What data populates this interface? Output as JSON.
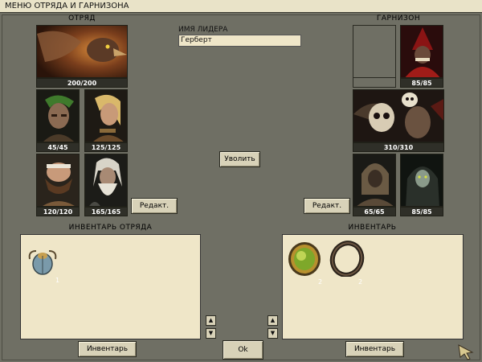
{
  "window": {
    "title": "МЕНЮ ОТРЯДА И ГАРНИЗОНА"
  },
  "party": {
    "header": "ОТРЯД",
    "units": [
      {
        "name": "griffin",
        "hp": "200/200"
      },
      {
        "name": "green-haired-elf",
        "hp": "45/45"
      },
      {
        "name": "blonde-warrior",
        "hp": "125/125"
      },
      {
        "name": "bald-dwarf",
        "hp": "120/120"
      },
      {
        "name": "grey-bearded-elder",
        "hp": "165/165"
      }
    ],
    "edit_label": "Редакт."
  },
  "leader": {
    "label": "ИМЯ ЛИДЕРА",
    "name": "Герберт"
  },
  "dismiss_label": "Уволить",
  "garrison": {
    "header": "ГАРНИЗОН",
    "units": [
      {
        "name": "red-hooded-cultist",
        "hp": "85/85"
      },
      {
        "name": "skull-shaman",
        "hp": "310/310"
      },
      {
        "name": "hooded-ghoul",
        "hp": "65/65"
      },
      {
        "name": "dark-cloaked-figure",
        "hp": "85/85"
      }
    ],
    "edit_label": "Редакт."
  },
  "party_inventory": {
    "header": "ИНВЕНТАРЬ ОТРЯДА",
    "items": [
      {
        "icon": "scarab-amulet-icon",
        "qty": "1"
      }
    ],
    "button_label": "Инвентарь"
  },
  "inventory": {
    "header": "ИНВЕНТАРЬ",
    "items": [
      {
        "icon": "gold-ring-icon",
        "qty": "2"
      },
      {
        "icon": "dark-ring-icon",
        "qty": "2"
      }
    ],
    "button_label": "Инвентарь"
  },
  "ok_label": "Ok",
  "scroll": {
    "up": "▲",
    "down": "▼"
  },
  "colors": {
    "background": "#6f6f64",
    "panel": "#efe6c8",
    "button": "#d8d2b8",
    "title_bar": "#e9e3c8"
  }
}
